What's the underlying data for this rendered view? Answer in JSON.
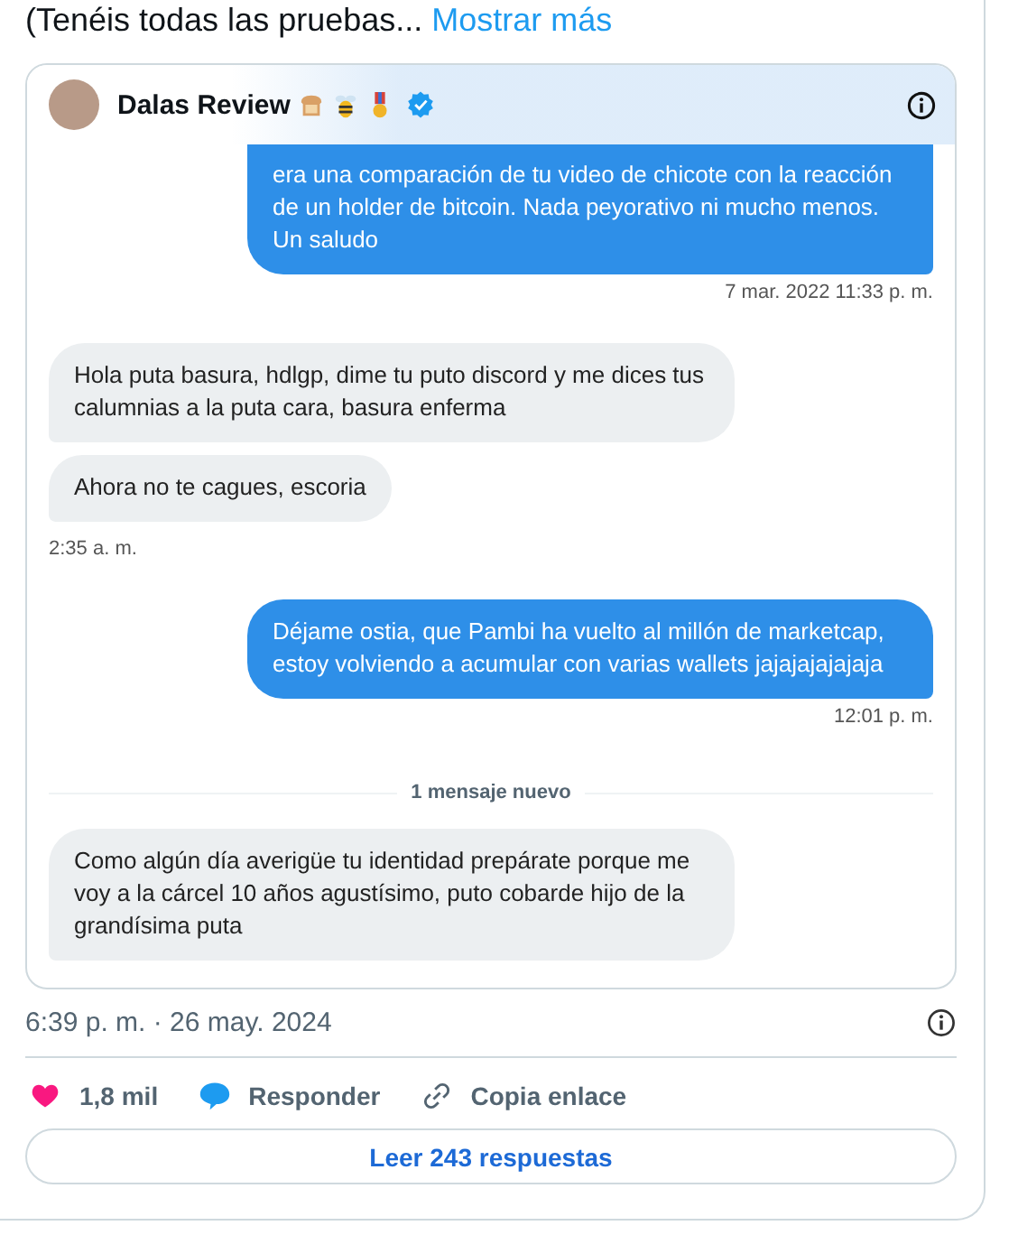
{
  "tweet_text": {
    "text": "(Tenéis todas las pruebas...",
    "link": "Mostrar más"
  },
  "screenshot": {
    "contact": {
      "name": "Dalas Review",
      "verified": true
    },
    "conversation": [
      {
        "kind": "sent",
        "text": "era una comparación de tu video de chicote con la reacción de un holder de bitcoin. Nada peyorativo ni mucho menos. Un saludo",
        "cut_top": true
      },
      {
        "kind": "time_sent",
        "text": "7 mar. 2022 11:33 p. m."
      },
      {
        "kind": "received",
        "text": "Hola puta basura, hdlgp, dime tu puto discord y me dices tus calumnias a la puta cara, basura enferma"
      },
      {
        "kind": "received",
        "text": "Ahora no te cagues, escoria"
      },
      {
        "kind": "time_received",
        "text": "2:35 a. m."
      },
      {
        "kind": "sent",
        "text": "Déjame ostia, que Pambi ha vuelto al millón de marketcap, estoy volviendo a acumular con varias wallets jajajajajajaja"
      },
      {
        "kind": "time_sent",
        "text": "12:01 p. m."
      },
      {
        "kind": "divider",
        "text": "1 mensaje nuevo"
      },
      {
        "kind": "received",
        "text": "Como algún día averigüe tu identidad prepárate porque me voy a la cárcel 10 años agustísimo, puto cobarde hijo de la grandísima puta"
      }
    ]
  },
  "timestamp": "6:39 p. m. · 26 may. 2024",
  "actions": [
    {
      "kind": "like",
      "label": "1,8 mil"
    },
    {
      "kind": "reply",
      "label": "Responder"
    },
    {
      "kind": "copy",
      "label": "Copia enlace"
    }
  ],
  "read_replies_button": "Leer 243 respuestas"
}
